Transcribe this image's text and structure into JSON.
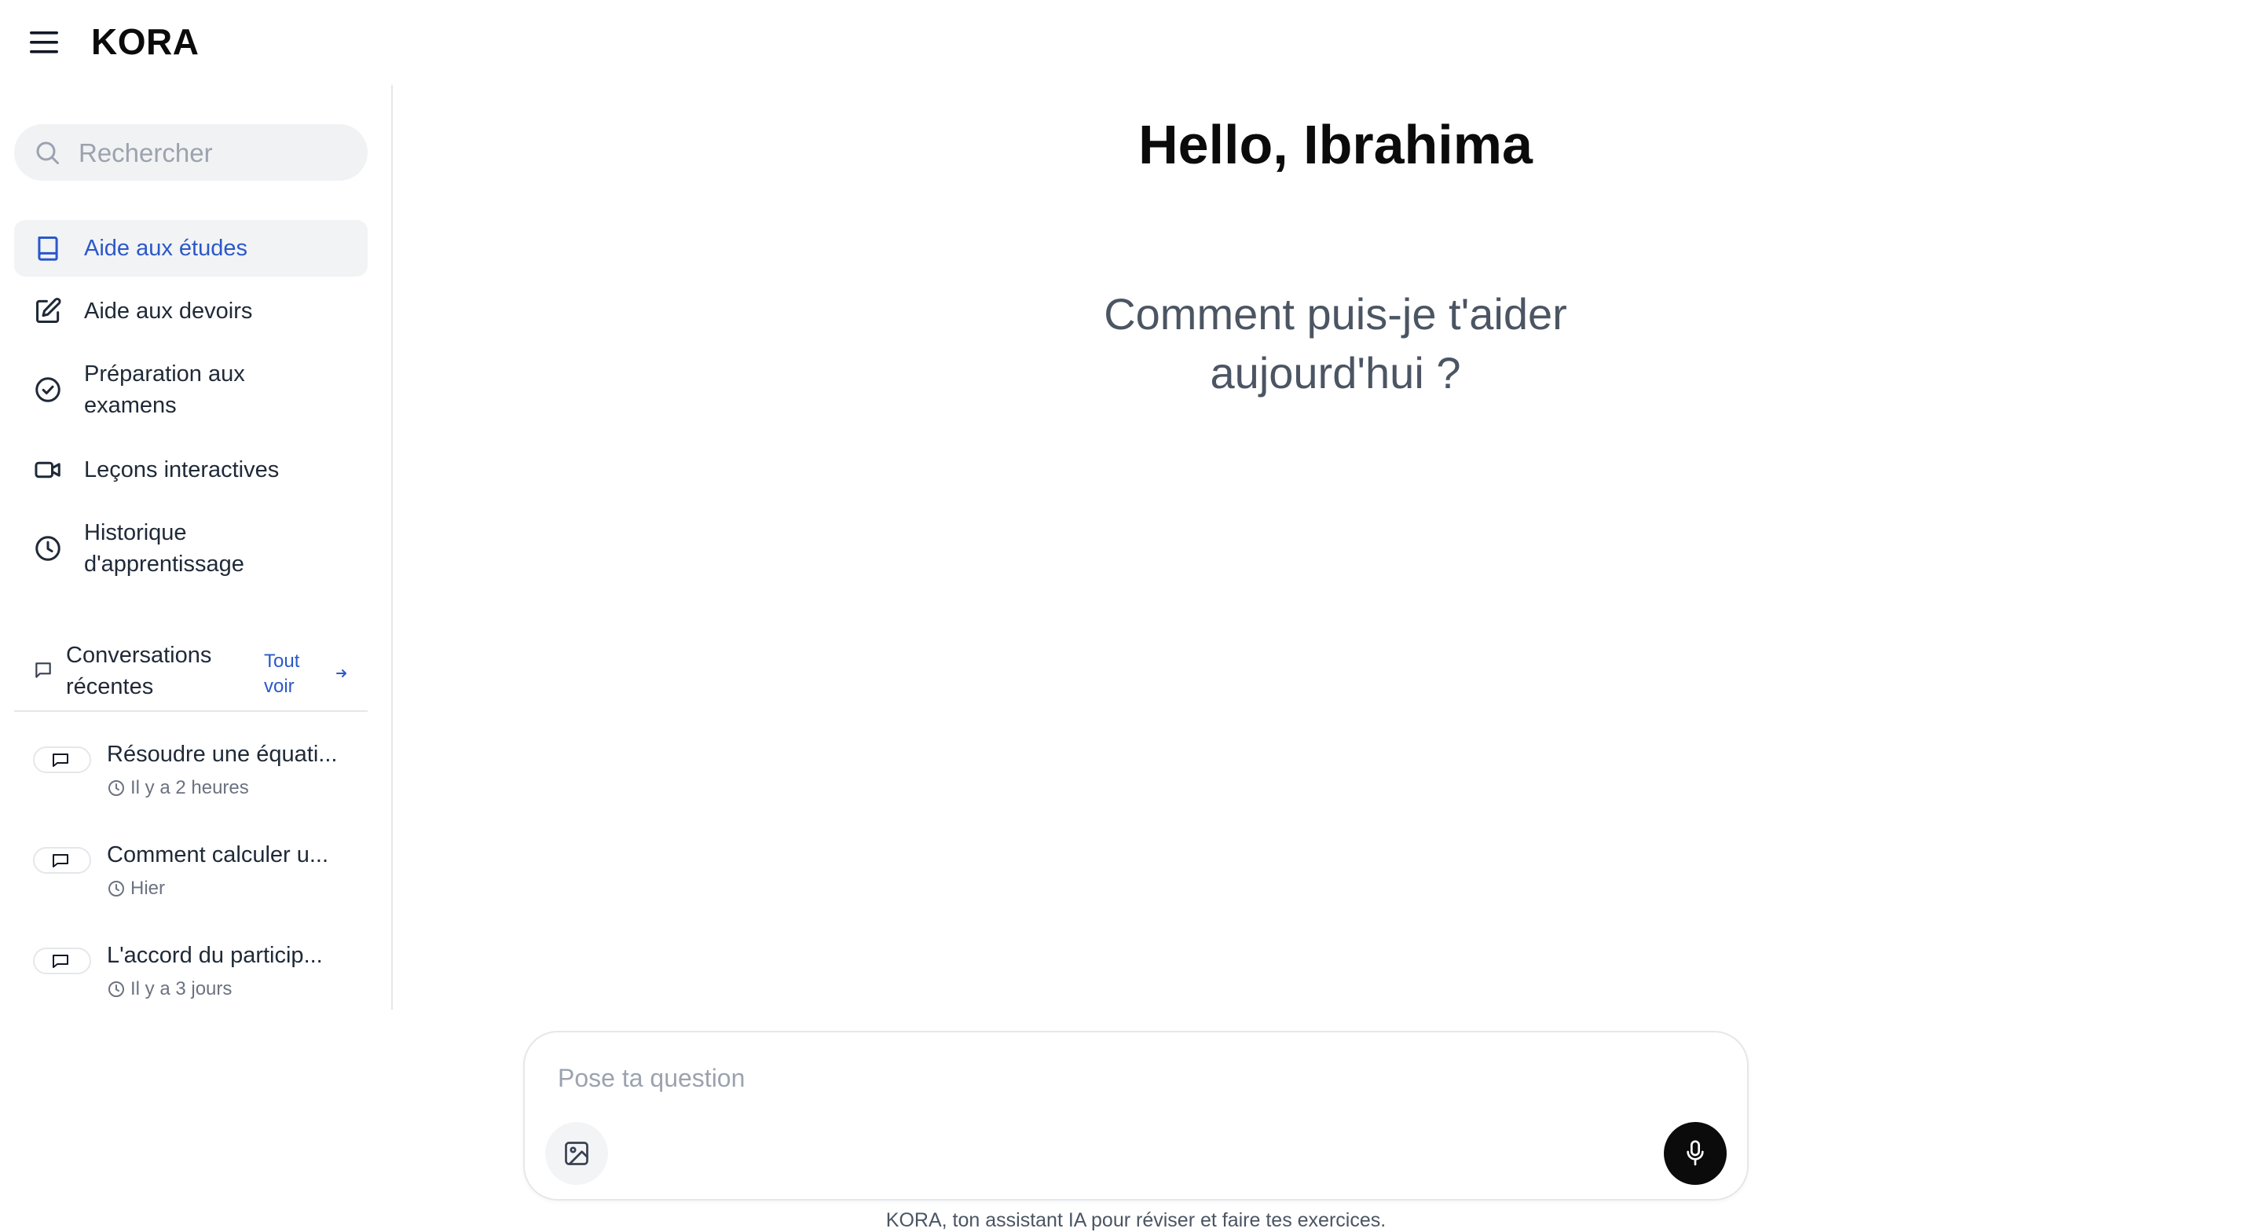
{
  "app": {
    "brand": "KORA"
  },
  "sidebar": {
    "search_placeholder": "Rechercher",
    "nav": [
      {
        "label": "Aide aux études",
        "icon": "book-icon",
        "active": true
      },
      {
        "label": "Aide aux devoirs",
        "icon": "edit-icon"
      },
      {
        "label": "Préparation aux examens",
        "icon": "check-circle-icon"
      },
      {
        "label": "Leçons interactives",
        "icon": "video-icon"
      },
      {
        "label": "Historique d'apprentissage",
        "icon": "clock-icon"
      }
    ],
    "recent": {
      "title": "Conversations récentes",
      "see_all": "Tout voir",
      "items": [
        {
          "title": "Résoudre une équati...",
          "time": "Il y a 2 heures"
        },
        {
          "title": "Comment calculer u...",
          "time": "Hier"
        },
        {
          "title": "L'accord du particip...",
          "time": "Il y a 3 jours"
        }
      ]
    }
  },
  "main": {
    "greeting": "Hello, Ibrahima",
    "subtitle": "Comment puis-je t'aider aujourd'hui ?",
    "composer": {
      "placeholder": "Pose ta question"
    },
    "footer": "KORA, ton assistant IA pour réviser et faire tes exercices."
  },
  "colors": {
    "accent": "#2b58c9",
    "active_bg": "#f2f3f5",
    "mic_button": "#0b0b0b"
  }
}
